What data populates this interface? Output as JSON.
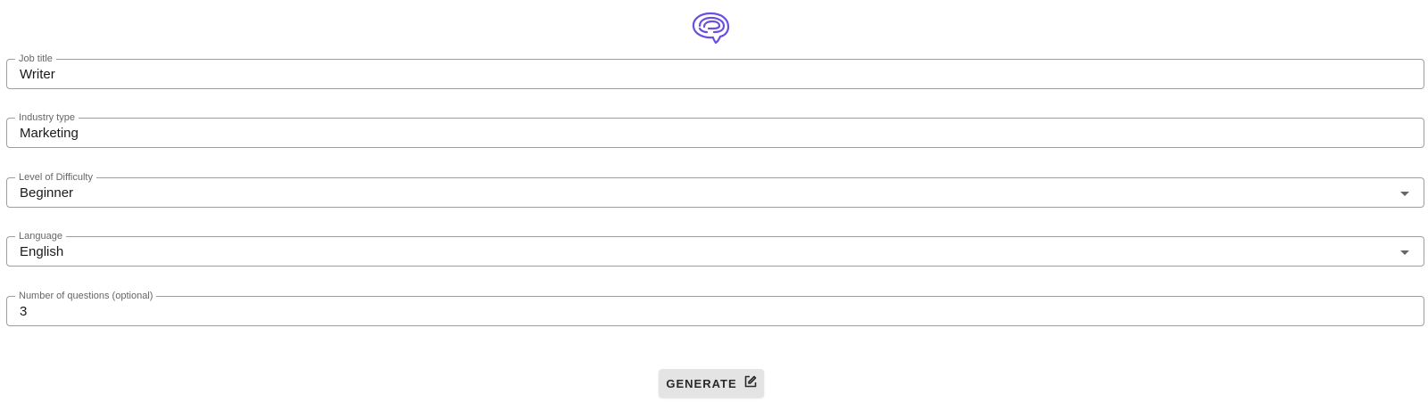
{
  "logo": {
    "icon": "brain-speech-bubble-icon",
    "color": "#6b4fe0"
  },
  "form": {
    "fields": [
      {
        "label": "Job title",
        "value": "Writer",
        "type": "text"
      },
      {
        "label": "Industry type",
        "value": "Marketing",
        "type": "text"
      },
      {
        "label": "Level of Difficulty",
        "value": "Beginner",
        "type": "select"
      },
      {
        "label": "Language",
        "value": "English",
        "type": "select"
      },
      {
        "label": "Number of questions (optional)",
        "value": "3",
        "type": "text"
      }
    ]
  },
  "actions": {
    "generate_label": "GENERATE",
    "generate_icon": "edit-icon"
  }
}
